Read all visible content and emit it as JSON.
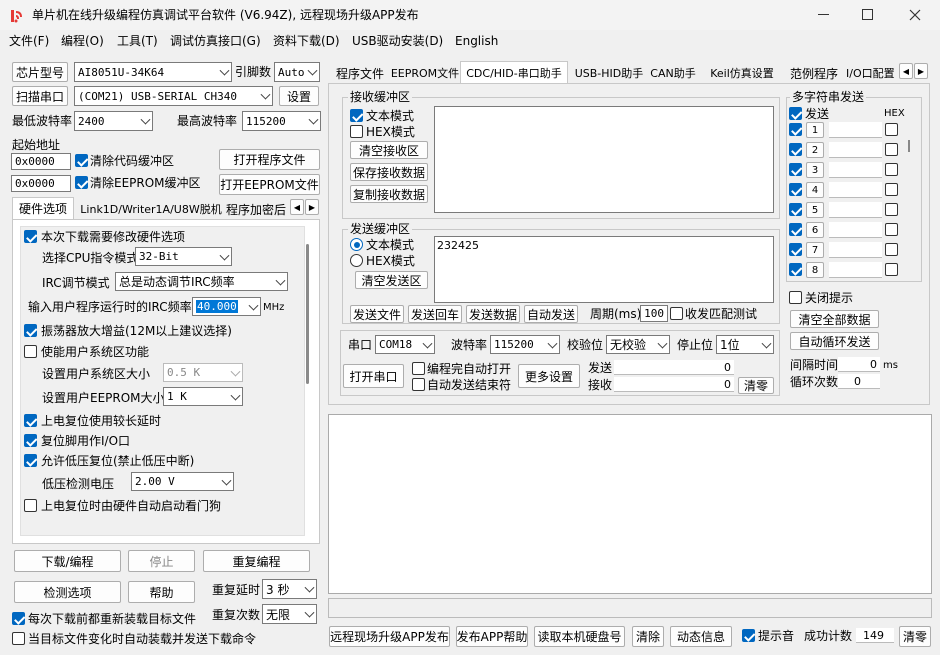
{
  "window": {
    "title": "单片机在线升级编程仿真调试平台软件 (V6.94Z), 远程现场升级APP发布"
  },
  "menu": [
    "文件(F)",
    "编程(O)",
    "工具(T)",
    "调试仿真接口(G)",
    "资料下载(D)",
    "USB驱动安装(D)",
    "English"
  ],
  "left": {
    "chip_label": "芯片型号",
    "chip_value": "AI8051U-34K64",
    "pin_label": "引脚数",
    "pin_value": "Auto",
    "scan_button": "扫描串口",
    "port_value": "(COM21) USB-SERIAL CH340",
    "settings_button": "设置",
    "min_baud_label": "最低波特率",
    "min_baud_value": "2400",
    "max_baud_label": "最高波特率",
    "max_baud_value": "115200",
    "start_addr_label": "起始地址",
    "addr1": "0x0000",
    "clear_code_label": "清除代码缓冲区",
    "open_prog_button": "打开程序文件",
    "addr2": "0x0000",
    "clear_eeprom_label": "清除EEPROM缓冲区",
    "open_eeprom_button": "打开EEPROM文件",
    "tabs": [
      "硬件选项",
      "Link1D/Writer1A/U8W脱机",
      "程序加密后"
    ],
    "opt_modify": "本次下载需要修改硬件选项",
    "opt_cpu_label": "选择CPU指令模式",
    "opt_cpu_value": "32-Bit",
    "opt_irc_label": "IRC调节模式",
    "opt_irc_value": "总是动态调节IRC频率",
    "opt_freq_label": "输入用户程序运行时的IRC频率",
    "opt_freq_value": "40.000",
    "opt_freq_unit": "MHz",
    "opt_osc": "振荡器放大增益(12M以上建议选择)",
    "opt_sysarea": "使能用户系统区功能",
    "opt_sysarea_size_label": "设置用户系统区大小",
    "opt_sysarea_size_value": "0.5 K",
    "opt_eeprom_size_label": "设置用户EEPROM大小",
    "opt_eeprom_size_value": "1   K",
    "opt_reset_delay": "上电复位使用较长延时",
    "opt_reset_pin": "复位脚用作I/O口",
    "opt_lvr": "允许低压复位(禁止低压中断)",
    "opt_lvr_label": "低压检测电压",
    "opt_lvr_value": "2.00 V",
    "opt_wdt": "上电复位时由硬件自动启动看门狗",
    "download_button": "下载/编程",
    "stop_button": "停止",
    "redownload_button": "重复编程",
    "detect_button": "检测选项",
    "help_button": "帮助",
    "repeat_delay_label": "重复延时",
    "repeat_delay_value": "3 秒",
    "repeat_count_label": "重复次数",
    "repeat_count_value": "无限",
    "reload_label": "每次下载前都重新装载目标文件",
    "auto_label": "当目标文件变化时自动装载并发送下载命令"
  },
  "right": {
    "tabs": [
      "程序文件",
      "EEPROM文件",
      "CDC/HID-串口助手",
      "USB-HID助手",
      "CAN助手",
      "Keil仿真设置",
      "范例程序",
      "I/O口配置"
    ],
    "recv": {
      "title": "接收缓冲区",
      "text_mode": "文本模式",
      "hex_mode": "HEX模式",
      "clear": "清空接收区",
      "save": "保存接收数据",
      "copy": "复制接收数据"
    },
    "send": {
      "title": "发送缓冲区",
      "text_mode": "文本模式",
      "hex_mode": "HEX模式",
      "clear": "清空发送区",
      "content": "232425"
    },
    "send_file": "发送文件",
    "send_back": "发送回车",
    "send_data": "发送数据",
    "auto_send": "自动发送",
    "period_label": "周期(ms)",
    "period_value": "100",
    "match_label": "收发匹配测试",
    "port_label": "串口",
    "port_value": "COM18",
    "baud_label": "波特率",
    "baud_value": "115200",
    "parity_label": "校验位",
    "parity_value": "无校验",
    "stop_label": "停止位",
    "stop_value": "1位",
    "open_port": "打开串口",
    "auto_open": "编程完自动打开",
    "auto_end": "自动发送结束符",
    "more_settings": "更多设置",
    "tx_label": "发送",
    "tx_value": "0",
    "rx_label": "接收",
    "rx_value": "0",
    "clear_count": "清零",
    "multi": {
      "title": "多字符串发送",
      "send_header": "发送",
      "hex_header": "HEX",
      "rows": [
        "1",
        "2",
        "3",
        "4",
        "5",
        "6",
        "7",
        "8"
      ]
    },
    "close_prompt": "关闭提示",
    "clear_all": "清空全部数据",
    "auto_loop": "自动循环发送",
    "interval_label": "间隔时间",
    "interval_value": "0",
    "interval_unit": "ms",
    "loop_label": "循环次数",
    "loop_value": "0"
  },
  "bottom": {
    "remote_publish": "远程现场升级APP发布",
    "publish_help": "发布APP帮助",
    "read_disk": "读取本机硬盘号",
    "clear": "清除",
    "dynamic_info": "动态信息",
    "beep_label": "提示音",
    "success_label": "成功计数",
    "success_value": "149",
    "clear_count": "清零"
  },
  "colors": {
    "accent": "#0067c0",
    "bg": "#f0f0f0"
  }
}
